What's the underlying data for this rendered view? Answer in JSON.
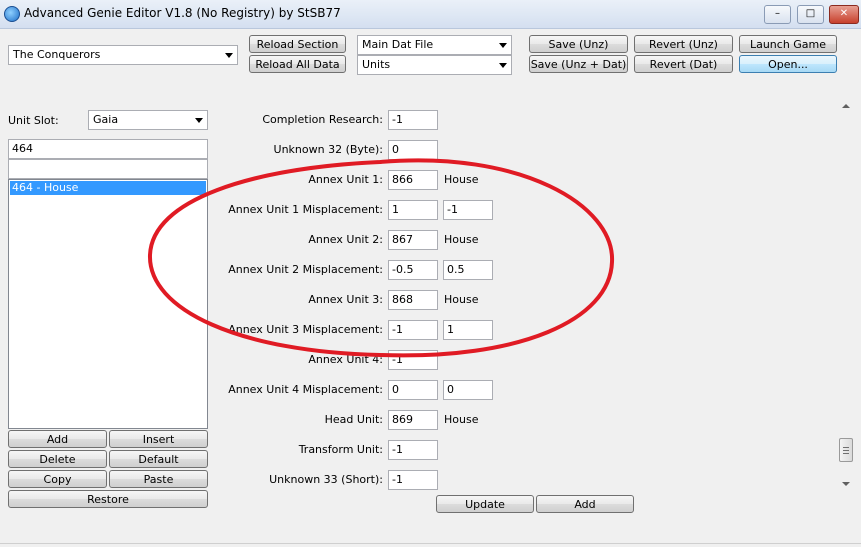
{
  "window": {
    "title": "Advanced Genie Editor V1.8 (No Registry) by StSB77"
  },
  "toolbar": {
    "game_select": "The Conquerors",
    "reload_section": "Reload Section",
    "reload_all": "Reload All Data",
    "file_select": "Main Dat File",
    "section_select": "Units",
    "save_unz": "Save (Unz)",
    "save_unz_dat": "Save (Unz + Dat)",
    "revert_unz": "Revert (Unz)",
    "revert_dat": "Revert (Dat)",
    "launch_game": "Launch Game",
    "open": "Open..."
  },
  "left_panel": {
    "unit_slot_label": "Unit Slot:",
    "unit_slot_value": "Gaia",
    "search_value": "464",
    "filter_value": "",
    "list_items": [
      "464 - House"
    ],
    "buttons": {
      "add": "Add",
      "insert": "Insert",
      "delete": "Delete",
      "default": "Default",
      "copy": "Copy",
      "paste": "Paste",
      "restore": "Restore"
    }
  },
  "fields": [
    {
      "label": "Completion Research:",
      "value1": "-1"
    },
    {
      "label": "Unknown 32 (Byte):",
      "value1": "0"
    },
    {
      "label": "Annex Unit 1:",
      "value1": "866",
      "note": "House"
    },
    {
      "label": "Annex Unit 1 Misplacement:",
      "value1": "1",
      "value2": "-1"
    },
    {
      "label": "Annex Unit 2:",
      "value1": "867",
      "note": "House"
    },
    {
      "label": "Annex Unit 2 Misplacement:",
      "value1": "-0.5",
      "value2": "0.5"
    },
    {
      "label": "Annex Unit 3:",
      "value1": "868",
      "note": "House"
    },
    {
      "label": "Annex Unit 3 Misplacement:",
      "value1": "-1",
      "value2": "1"
    },
    {
      "label": "Annex Unit 4:",
      "value1": "-1"
    },
    {
      "label": "Annex Unit 4 Misplacement:",
      "value1": "0",
      "value2": "0"
    },
    {
      "label": "Head Unit:",
      "value1": "869",
      "note": "House"
    },
    {
      "label": "Transform Unit:",
      "value1": "-1"
    },
    {
      "label": "Unknown 33 (Short):",
      "value1": "-1"
    }
  ],
  "actions": {
    "update": "Update",
    "add": "Add"
  },
  "annotation": {
    "color": "#e01b24"
  }
}
